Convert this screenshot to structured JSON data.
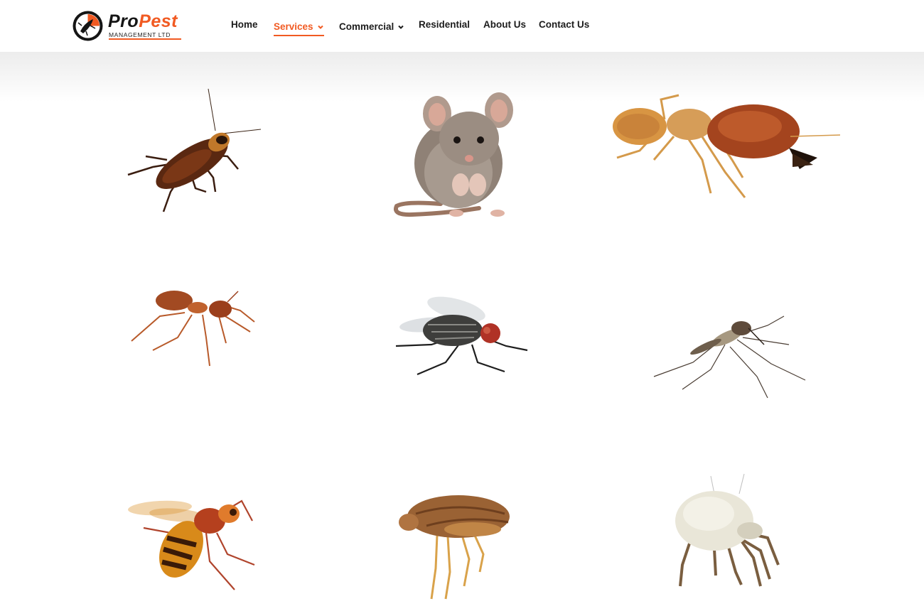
{
  "brand": {
    "name_part1": "Pro",
    "name_part2": "Pest",
    "tagline": "MANAGEMENT LTD",
    "accent_color": "#f15a22"
  },
  "nav": {
    "items": [
      {
        "label": "Home",
        "active": false,
        "dropdown": false
      },
      {
        "label": "Services",
        "active": true,
        "dropdown": true
      },
      {
        "label": "Commercial",
        "active": false,
        "dropdown": true
      },
      {
        "label": "Residential",
        "active": false,
        "dropdown": false
      },
      {
        "label": "About Us",
        "active": false,
        "dropdown": false
      },
      {
        "label": "Contact Us",
        "active": false,
        "dropdown": false
      }
    ]
  },
  "pests": [
    {
      "icon": "cockroach-image"
    },
    {
      "icon": "mouse-image"
    },
    {
      "icon": "termite-image"
    },
    {
      "icon": "ant-image"
    },
    {
      "icon": "fly-image"
    },
    {
      "icon": "mosquito-image"
    },
    {
      "icon": "wasp-image"
    },
    {
      "icon": "flea-image"
    },
    {
      "icon": "dust-mite-image"
    }
  ]
}
